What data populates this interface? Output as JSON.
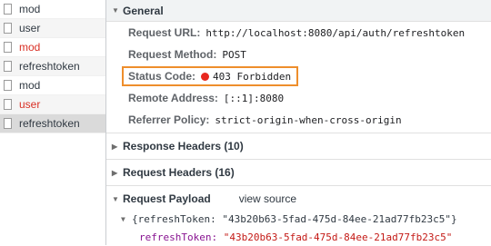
{
  "requests": [
    {
      "name": "mod",
      "error": false
    },
    {
      "name": "user",
      "error": false
    },
    {
      "name": "mod",
      "error": true
    },
    {
      "name": "refreshtoken",
      "error": false
    },
    {
      "name": "mod",
      "error": false
    },
    {
      "name": "user",
      "error": true
    },
    {
      "name": "refreshtoken",
      "error": false,
      "selected": true
    }
  ],
  "general": {
    "title": "General",
    "request_url_label": "Request URL:",
    "request_url": "http://localhost:8080/api/auth/refreshtoken",
    "request_method_label": "Request Method:",
    "request_method": "POST",
    "status_code_label": "Status Code:",
    "status_code": "403 Forbidden",
    "remote_address_label": "Remote Address:",
    "remote_address": "[::1]:8080",
    "referrer_policy_label": "Referrer Policy:",
    "referrer_policy": "strict-origin-when-cross-origin"
  },
  "response_headers": {
    "title": "Response Headers (10)"
  },
  "request_headers": {
    "title": "Request Headers (16)"
  },
  "payload": {
    "title": "Request Payload",
    "view_source": "view source",
    "summary": "{refreshToken: \"43b20b63-5fad-475d-84ee-21ad77fb23c5\"}",
    "key": "refreshToken:",
    "value": "\"43b20b63-5fad-475d-84ee-21ad77fb23c5\""
  },
  "colors": {
    "error": "#d93025",
    "status_dot": "#e8271f",
    "highlight_box": "#ee8e2c"
  },
  "icons": {
    "expanded": "triangle-down",
    "collapsed": "triangle-right"
  }
}
